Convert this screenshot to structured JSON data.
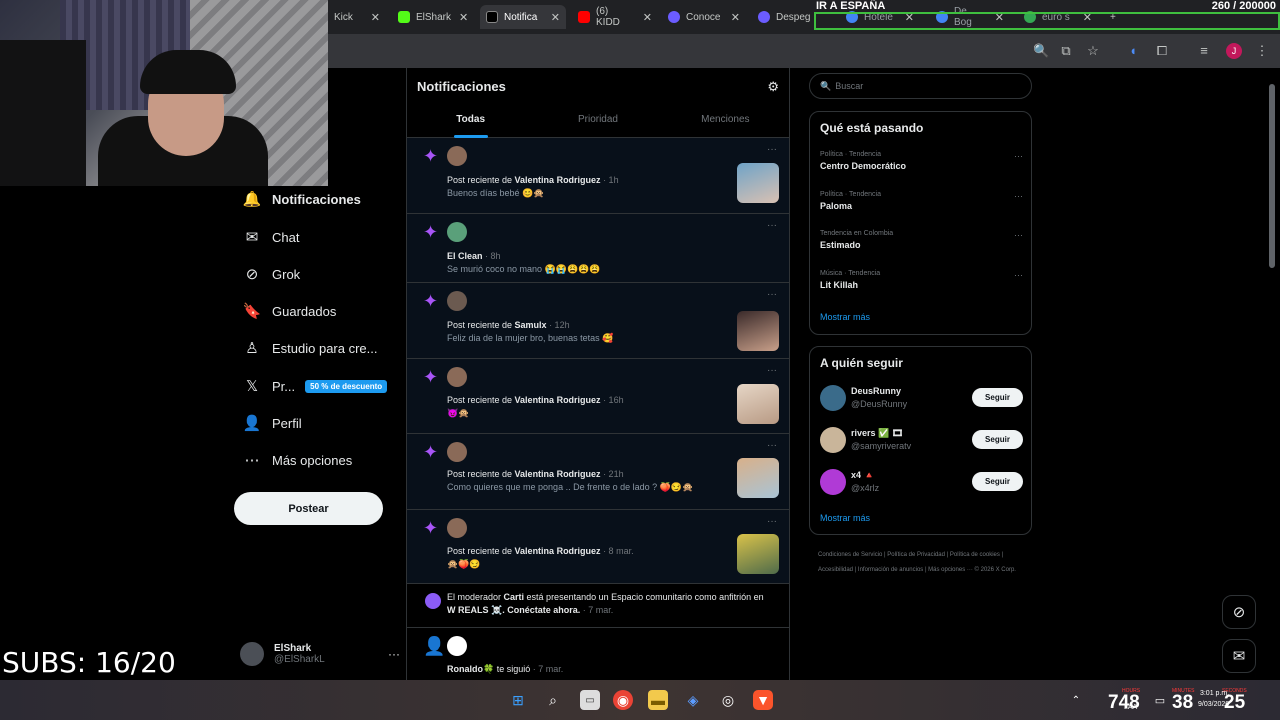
{
  "browser": {
    "tabs": [
      {
        "label": "Kick",
        "color": "#53fc18"
      },
      {
        "label": "ElShark",
        "color": "#53fc18"
      },
      {
        "label": "Notifica",
        "color": "#000000"
      },
      {
        "label": "(6) KIDD",
        "color": "#ff0000"
      },
      {
        "label": "Conoce",
        "color": "#6b5cff"
      },
      {
        "label": "Despeg",
        "color": "#6b5cff"
      },
      {
        "label": "Hotele",
        "color": "#4285f4"
      },
      {
        "label": "De Bog",
        "color": "#4285f4"
      },
      {
        "label": "euro s",
        "color": "#34a853"
      }
    ],
    "close_glyph": "✕",
    "new_tab_glyph": "+"
  },
  "overlay": {
    "goal_label": "IR A ESPAÑA",
    "goal_count": "260 / 200000",
    "subs": "SUBS: 16/20"
  },
  "nav": {
    "items": [
      {
        "label": "Notificaciones",
        "icon": "bell-icon",
        "glyph": "🔔"
      },
      {
        "label": "Chat",
        "icon": "mail-icon",
        "glyph": "✉"
      },
      {
        "label": "Grok",
        "icon": "grok-icon",
        "glyph": "⊘"
      },
      {
        "label": "Guardados",
        "icon": "bookmark-icon",
        "glyph": "🔖"
      },
      {
        "label": "Estudio para cre...",
        "icon": "studio-icon",
        "glyph": "♙"
      },
      {
        "label": "Pr...",
        "icon": "x-logo-icon",
        "glyph": "𝕏"
      },
      {
        "label": "Perfil",
        "icon": "person-icon",
        "glyph": "👤"
      },
      {
        "label": "Más opciones",
        "icon": "more-circle-icon",
        "glyph": "⋯"
      }
    ],
    "promo": "50 % de descuento",
    "post_button": "Postear",
    "user": {
      "name": "ElShark",
      "handle": "@ElSharkL",
      "more": "···"
    }
  },
  "main": {
    "title": "Notificaciones",
    "tabs": [
      "Todas",
      "Prioridad",
      "Menciones"
    ],
    "dots": "···",
    "notifications": [
      {
        "prefix": "Post reciente de ",
        "name": "Valentina Rodriguez",
        "time": " · 1h",
        "text": "Buenos días bebé 😊🙊"
      },
      {
        "prefix": "",
        "name": "El Clean",
        "time": " · 8h",
        "text": "Se murió coco no mano 😭😭😩😩😩"
      },
      {
        "prefix": "Post reciente de ",
        "name": "Samulx",
        "time": " · 12h",
        "text": "Feliz dia de la mujer bro, buenas tetas 🥰"
      },
      {
        "prefix": "Post reciente de ",
        "name": "Valentina Rodriguez",
        "time": " · 16h",
        "text": "😈🙊"
      },
      {
        "prefix": "Post reciente de ",
        "name": "Valentina Rodriguez",
        "time": " · 21h",
        "text": "Como quieres que me ponga .. De frente o de lado ? 🍑😏🙊"
      },
      {
        "prefix": "Post reciente de ",
        "name": "Valentina Rodriguez",
        "time": " · 8 mar.",
        "text": "🙊🍑😏"
      }
    ],
    "space": {
      "pre": "El moderador ",
      "name": "Carti",
      "mid": " está presentando un Espacio comunitario como anfitrión en ",
      "community": "W REALS ☠️",
      "post": ". Conéctate ahora.",
      "time": " · 7 mar."
    },
    "follow": {
      "name": "Ronaldo🍀",
      "text": " te siguió",
      "time": " · 7 mar."
    }
  },
  "right": {
    "search_placeholder": "Buscar",
    "trends_title": "Qué está pasando",
    "trends": [
      {
        "context": "Política · Tendencia",
        "name": "Centro Democrático"
      },
      {
        "context": "Política · Tendencia",
        "name": "Paloma"
      },
      {
        "context": "Tendencia en Colombia",
        "name": "Estimado"
      },
      {
        "context": "Música · Tendencia",
        "name": "Lit Killah"
      }
    ],
    "show_more": "Mostrar más",
    "who_title": "A quién seguir",
    "who": [
      {
        "name": "DeusRunny",
        "handle": "@DeusRunny",
        "color": "#3a6b8a"
      },
      {
        "name": "rivers ✅ 🎞",
        "handle": "@samyriveratv",
        "color": "#c9b59a"
      },
      {
        "name": "x4 🔺",
        "handle": "@x4rlz",
        "color": "#b03ad6"
      }
    ],
    "follow_label": "Seguir",
    "footer": "Condiciones de Servicio | Política de Privacidad | Política de cookies | Accesibilidad | Información de anuncios | Más opciones ··· © 2026 X Corp."
  },
  "taskbar": {
    "timer_labels": [
      "HOURS",
      "MINUTES",
      "SECONDS"
    ],
    "timer_values": [
      "748",
      "38",
      "25"
    ],
    "time": "3:01 p.m.",
    "date": "9/03/2026",
    "lang": "LAA"
  },
  "colors": {
    "accent": "#1d9bf0",
    "star": "#a855f7",
    "goal_border": "#3fbf3f"
  }
}
